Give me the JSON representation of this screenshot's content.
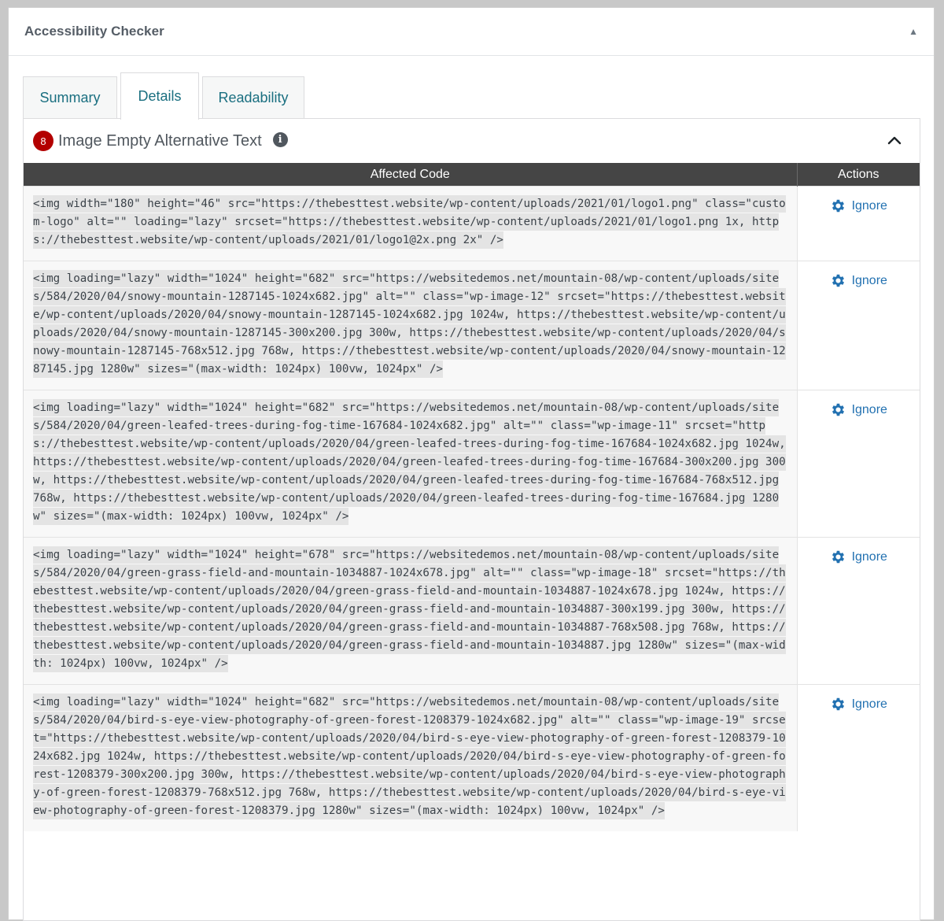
{
  "panel": {
    "title": "Accessibility Checker",
    "toggle_icon": "triangle-up-icon"
  },
  "tabs": [
    {
      "label": "Summary",
      "active": false
    },
    {
      "label": "Details",
      "active": true
    },
    {
      "label": "Readability",
      "active": false
    }
  ],
  "issue": {
    "count": "8",
    "title": "Image Empty Alternative Text",
    "info_icon": "info-icon",
    "collapse_icon": "chevron-up-icon"
  },
  "table": {
    "headers": {
      "code": "Affected Code",
      "actions": "Actions"
    },
    "ignore_label": "Ignore",
    "rows": [
      {
        "code": " <img width=\"180\" height=\"46\" src=\"https://thebesttest.website/wp-content/uploads/2021/01/logo1.png\" class=\"custom-logo\" alt=\"\" loading=\"lazy\" srcset=\"https://thebesttest.website/wp-content/uploads/2021/01/logo1.png 1x, https://thebesttest.website/wp-content/uploads/2021/01/logo1@2x.png 2x\" />"
      },
      {
        "code": " <img loading=\"lazy\" width=\"1024\" height=\"682\" src=\"https://websitedemos.net/mountain-08/wp-content/uploads/sites/584/2020/04/snowy-mountain-1287145-1024x682.jpg\" alt=\"\" class=\"wp-image-12\" srcset=\"https://thebesttest.website/wp-content/uploads/2020/04/snowy-mountain-1287145-1024x682.jpg 1024w, https://thebesttest.website/wp-content/uploads/2020/04/snowy-mountain-1287145-300x200.jpg 300w, https://thebesttest.website/wp-content/uploads/2020/04/snowy-mountain-1287145-768x512.jpg 768w, https://thebesttest.website/wp-content/uploads/2020/04/snowy-mountain-1287145.jpg 1280w\" sizes=\"(max-width: 1024px) 100vw, 1024px\" />"
      },
      {
        "code": " <img loading=\"lazy\" width=\"1024\" height=\"682\" src=\"https://websitedemos.net/mountain-08/wp-content/uploads/sites/584/2020/04/green-leafed-trees-during-fog-time-167684-1024x682.jpg\" alt=\"\" class=\"wp-image-11\" srcset=\"https://thebesttest.website/wp-content/uploads/2020/04/green-leafed-trees-during-fog-time-167684-1024x682.jpg 1024w, https://thebesttest.website/wp-content/uploads/2020/04/green-leafed-trees-during-fog-time-167684-300x200.jpg 300w, https://thebesttest.website/wp-content/uploads/2020/04/green-leafed-trees-during-fog-time-167684-768x512.jpg 768w, https://thebesttest.website/wp-content/uploads/2020/04/green-leafed-trees-during-fog-time-167684.jpg 1280w\" sizes=\"(max-width: 1024px) 100vw, 1024px\" />"
      },
      {
        "code": " <img loading=\"lazy\" width=\"1024\" height=\"678\" src=\"https://websitedemos.net/mountain-08/wp-content/uploads/sites/584/2020/04/green-grass-field-and-mountain-1034887-1024x678.jpg\" alt=\"\" class=\"wp-image-18\" srcset=\"https://thebesttest.website/wp-content/uploads/2020/04/green-grass-field-and-mountain-1034887-1024x678.jpg 1024w, https://thebesttest.website/wp-content/uploads/2020/04/green-grass-field-and-mountain-1034887-300x199.jpg 300w, https://thebesttest.website/wp-content/uploads/2020/04/green-grass-field-and-mountain-1034887-768x508.jpg 768w, https://thebesttest.website/wp-content/uploads/2020/04/green-grass-field-and-mountain-1034887.jpg 1280w\" sizes=\"(max-width: 1024px) 100vw, 1024px\" />"
      },
      {
        "code": " <img loading=\"lazy\" width=\"1024\" height=\"682\" src=\"https://websitedemos.net/mountain-08/wp-content/uploads/sites/584/2020/04/bird-s-eye-view-photography-of-green-forest-1208379-1024x682.jpg\" alt=\"\" class=\"wp-image-19\" srcset=\"https://thebesttest.website/wp-content/uploads/2020/04/bird-s-eye-view-photography-of-green-forest-1208379-1024x682.jpg 1024w, https://thebesttest.website/wp-content/uploads/2020/04/bird-s-eye-view-photography-of-green-forest-1208379-300x200.jpg 300w, https://thebesttest.website/wp-content/uploads/2020/04/bird-s-eye-view-photography-of-green-forest-1208379-768x512.jpg 768w, https://thebesttest.website/wp-content/uploads/2020/04/bird-s-eye-view-photography-of-green-forest-1208379.jpg 1280w\" sizes=\"(max-width: 1024px) 100vw, 1024px\" />"
      }
    ]
  },
  "colors": {
    "badge": "#b30000",
    "link": "#2271b1",
    "tab_text": "#1a6f80",
    "table_header": "#454545"
  }
}
